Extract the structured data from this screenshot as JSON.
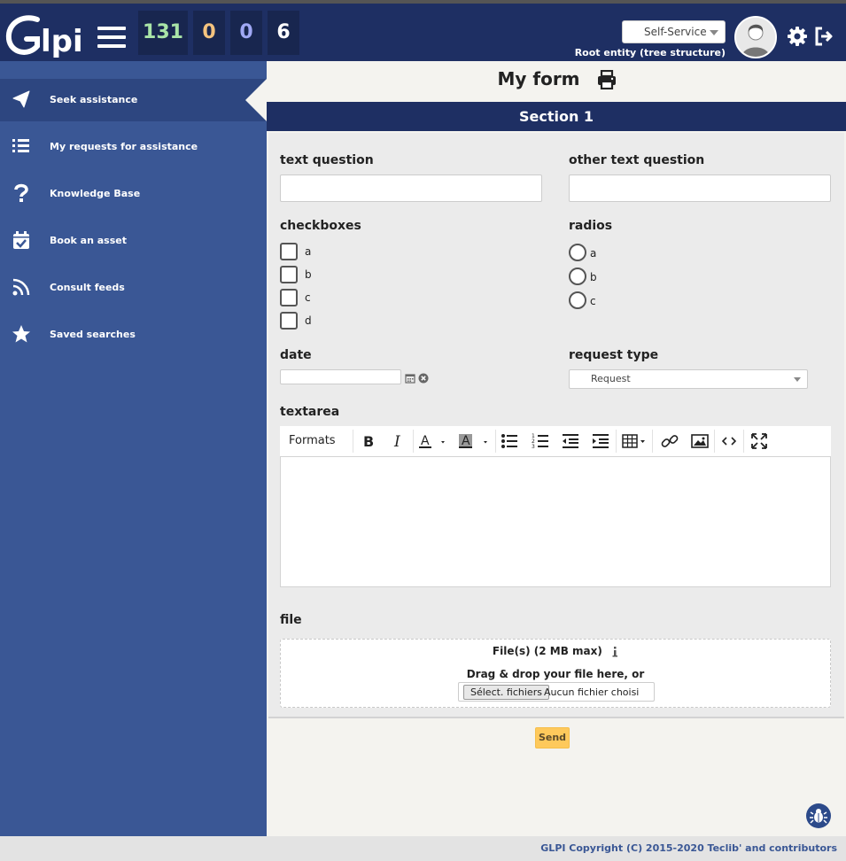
{
  "header": {
    "logo_text": "Glpi",
    "counters": [
      {
        "value": "131",
        "color": "#a9e4a7"
      },
      {
        "value": "0",
        "color": "#f4c37f"
      },
      {
        "value": "0",
        "color": "#a0a8f5"
      },
      {
        "value": "6",
        "color": "#ffffff"
      }
    ],
    "profile": "Self-Service",
    "entity": "Root entity (tree structure)",
    "icons": [
      "menu-icon",
      "user-avatar",
      "gear-icon",
      "logout-icon"
    ]
  },
  "sidebar": {
    "items": [
      {
        "label": "Seek assistance",
        "icon": "paper-plane-icon",
        "active": true
      },
      {
        "label": "My requests for assistance",
        "icon": "list-icon"
      },
      {
        "label": "Knowledge Base",
        "icon": "question-icon"
      },
      {
        "label": "Book an asset",
        "icon": "calendar-check-icon"
      },
      {
        "label": "Consult feeds",
        "icon": "rss-icon"
      },
      {
        "label": "Saved searches",
        "icon": "star-icon"
      }
    ]
  },
  "form": {
    "title": "My form",
    "section": "Section 1",
    "questions": {
      "text_question": "text question",
      "other_text_question": "other text question",
      "checkboxes": "checkboxes",
      "checkbox_options": [
        "a",
        "b",
        "c",
        "d"
      ],
      "radios": "radios",
      "radio_options": [
        "a",
        "b",
        "c"
      ],
      "date": "date",
      "request_type": "request type",
      "request_type_value": "Request",
      "textarea": "textarea",
      "file": "file"
    },
    "editor_toolbar": {
      "formats": "Formats"
    },
    "file_upload": {
      "title": "File(s) (2 MB max)",
      "drag_text": "Drag & drop your file here, or",
      "button": "Sélect. fichiers",
      "no_file": "Aucun fichier choisi"
    },
    "send": "Send"
  },
  "footer": {
    "copyright": "GLPI Copyright (C) 2015-2020 Teclib' and contributors"
  }
}
